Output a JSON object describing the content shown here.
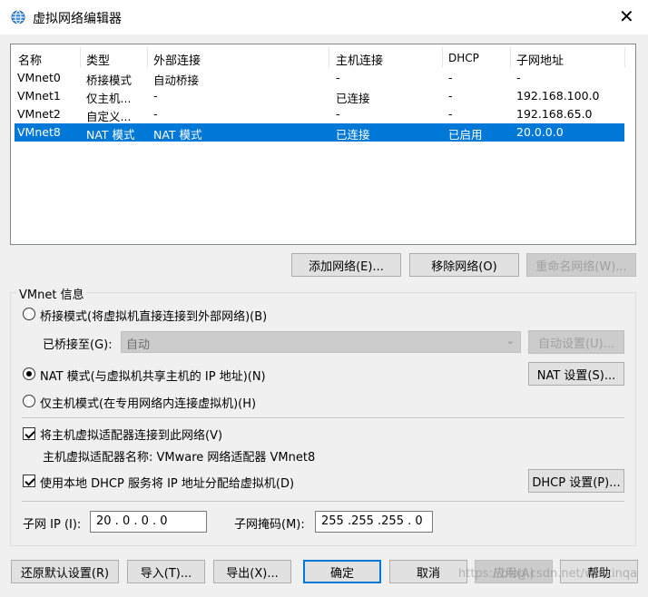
{
  "window": {
    "title": "虚拟网络编辑器",
    "close": "✕"
  },
  "table": {
    "headers": [
      "名称",
      "类型",
      "外部连接",
      "主机连接",
      "DHCP",
      "子网地址"
    ],
    "rows": [
      [
        "VMnet0",
        "桥接模式",
        "自动桥接",
        "-",
        "-",
        "-"
      ],
      [
        "VMnet1",
        "仅主机...",
        "-",
        "已连接",
        "-",
        "192.168.100.0"
      ],
      [
        "VMnet2",
        "自定义...",
        "-",
        "-",
        "-",
        "192.168.65.0"
      ],
      [
        "VMnet8",
        "NAT 模式",
        "NAT 模式",
        "已连接",
        "已启用",
        "20.0.0.0"
      ]
    ],
    "selected_row": 3
  },
  "net_buttons": {
    "add": "添加网络(E)...",
    "remove": "移除网络(O)",
    "rename": "重命名网络(W)..."
  },
  "info": {
    "group_label": "VMnet 信息",
    "bridge_mode": "桥接模式(将虚拟机直接连接到外部网络)(B)",
    "bridged_to_label": "已桥接至(G):",
    "bridged_to_value": "自动",
    "auto_settings": "自动设置(U)...",
    "nat_mode": "NAT 模式(与虚拟机共享主机的 IP 地址)(N)",
    "nat_settings": "NAT 设置(S)...",
    "host_only": "仅主机模式(在专用网络内连接虚拟机)(H)",
    "connect_adapter": "将主机虚拟适配器连接到此网络(V)",
    "adapter_name": "主机虚拟适配器名称: VMware 网络适配器 VMnet8",
    "use_dhcp": "使用本地 DHCP 服务将 IP 地址分配给虚拟机(D)",
    "dhcp_settings": "DHCP 设置(P)...",
    "subnet_ip_label": "子网 IP (I):",
    "subnet_ip": "20 .  0  .  0  .  0",
    "subnet_mask_label": "子网掩码(M):",
    "subnet_mask": "255 .255 .255 .  0"
  },
  "footer": {
    "restore": "还原默认设置(R)",
    "import": "导入(T)...",
    "export": "导出(X)...",
    "ok": "确定",
    "cancel": "取消",
    "apply": "应用(A)",
    "help": "帮助"
  },
  "watermark": "https://blog.csdn.net/weixinqa",
  "colors": {
    "selection": "#0078d7",
    "window_bg": "#f0f0f0"
  }
}
